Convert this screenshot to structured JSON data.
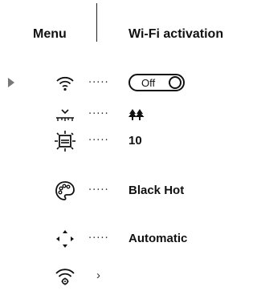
{
  "header": {
    "menu_label": "Menu",
    "title": "Wi-Fi activation"
  },
  "rows": [
    {
      "icon": "wifi-icon",
      "value": "",
      "selected": true,
      "type": "toggle",
      "toggle": {
        "label": "Off",
        "state": "off"
      }
    },
    {
      "icon": "calibration-icon",
      "value": "",
      "type": "trees"
    },
    {
      "icon": "zoom-frame-icon",
      "value": "10"
    },
    {
      "icon": "palette-icon",
      "value": "Black Hot"
    },
    {
      "icon": "arrows-icon",
      "value": "Automatic"
    },
    {
      "icon": "wifi-settings-icon",
      "type": "submenu",
      "chevron": "›"
    }
  ],
  "dots": "·····",
  "colors": {
    "text": "#111111",
    "pointer": "#777777",
    "background": "#ffffff"
  }
}
